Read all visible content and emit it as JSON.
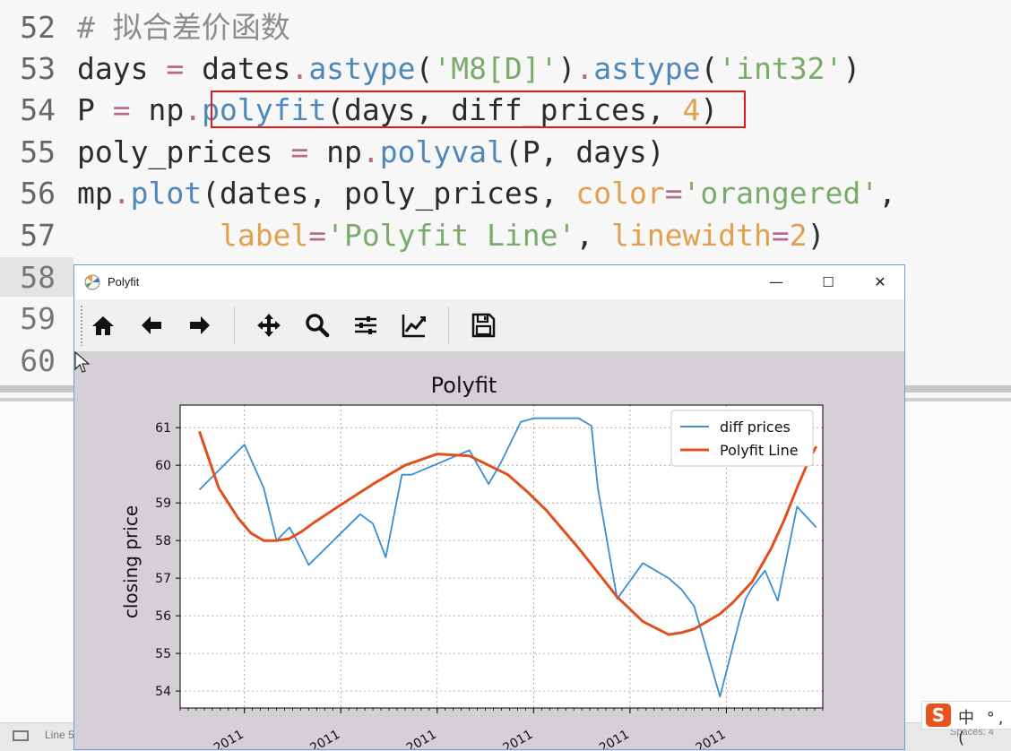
{
  "editor": {
    "lines": [
      {
        "num": "52",
        "tokens": [
          [
            "cm",
            "# 拟合差价函数"
          ]
        ]
      },
      {
        "num": "53",
        "tokens": [
          [
            "id",
            "days "
          ],
          [
            "op",
            "="
          ],
          [
            "id",
            " dates"
          ],
          [
            "op",
            "."
          ],
          [
            "fn",
            "astype"
          ],
          [
            "id",
            "("
          ],
          [
            "str",
            "'M8[D]'"
          ],
          [
            "id",
            ")"
          ],
          [
            "op",
            "."
          ],
          [
            "fn",
            "astype"
          ],
          [
            "id",
            "("
          ],
          [
            "str",
            "'int32'"
          ],
          [
            "id",
            ")"
          ]
        ]
      },
      {
        "num": "54",
        "tokens": [
          [
            "id",
            "P "
          ],
          [
            "op",
            "="
          ],
          [
            "id",
            " np"
          ],
          [
            "op",
            "."
          ],
          [
            "fn",
            "polyfit"
          ],
          [
            "id",
            "(days, diff_prices, "
          ],
          [
            "num",
            "4"
          ],
          [
            "id",
            ")"
          ]
        ]
      },
      {
        "num": "55",
        "tokens": [
          [
            "id",
            "poly_prices "
          ],
          [
            "op",
            "="
          ],
          [
            "id",
            " np"
          ],
          [
            "op",
            "."
          ],
          [
            "fn",
            "polyval"
          ],
          [
            "id",
            "(P, days)"
          ]
        ]
      },
      {
        "num": "56",
        "tokens": [
          [
            "id",
            "mp"
          ],
          [
            "op",
            "."
          ],
          [
            "fn",
            "plot"
          ],
          [
            "id",
            "(dates, poly_prices, "
          ],
          [
            "kw",
            "color"
          ],
          [
            "op",
            "="
          ],
          [
            "str",
            "'orangered'"
          ],
          [
            "id",
            ","
          ]
        ]
      },
      {
        "num": "57",
        "tokens": [
          [
            "id",
            "        "
          ],
          [
            "kw",
            "label"
          ],
          [
            "op",
            "="
          ],
          [
            "str",
            "'Polyfit Line'"
          ],
          [
            "id",
            ", "
          ],
          [
            "kw",
            "linewidth"
          ],
          [
            "op",
            "="
          ],
          [
            "num",
            "2"
          ],
          [
            "id",
            ")"
          ]
        ]
      },
      {
        "num": "58",
        "tokens": []
      },
      {
        "num": "59",
        "tokens": []
      },
      {
        "num": "60",
        "tokens": []
      }
    ]
  },
  "status": {
    "line_label": "Line 5",
    "spaces_label": "Spaces: 4"
  },
  "ime": {
    "logo": "S",
    "text": "中 °, ("
  },
  "window": {
    "title": "Polyfit",
    "minimize": "—",
    "maximize": "☐",
    "close": "✕",
    "toolbar": [
      "home-icon",
      "back-arrow-icon",
      "forward-arrow-icon",
      "pan-icon",
      "zoom-icon",
      "subplots-icon",
      "edit-axis-icon",
      "save-icon"
    ]
  },
  "colors": {
    "diff": "#3a8fd1",
    "poly": "#e0501e",
    "highlight": "#e0191c"
  },
  "chart_data": {
    "type": "line",
    "title": "Polyfit",
    "xlabel": "",
    "ylabel": "closing price",
    "ylim": [
      53.55,
      61.6
    ],
    "yticks": [
      54,
      55,
      56,
      57,
      58,
      59,
      60,
      61
    ],
    "xticks": [
      "2011",
      "2011",
      "2011",
      "2011",
      "2011",
      "2011"
    ],
    "grid": true,
    "legend_position": "top-right",
    "series": [
      {
        "name": "diff prices",
        "color": "#3a8fd1",
        "x": [
          0.03,
          0.1,
          0.13,
          0.15,
          0.17,
          0.18,
          0.2,
          0.28,
          0.3,
          0.32,
          0.345,
          0.36,
          0.45,
          0.48,
          0.5,
          0.53,
          0.55,
          0.6,
          0.61,
          0.62,
          0.64,
          0.65,
          0.68,
          0.72,
          0.76,
          0.78,
          0.8,
          0.84,
          0.87,
          0.88,
          0.89,
          0.91,
          0.93,
          0.96,
          0.99
        ],
        "y": [
          59.35,
          60.55,
          59.4,
          58.0,
          58.35,
          58.05,
          57.35,
          58.7,
          58.45,
          57.55,
          59.75,
          59.75,
          60.4,
          59.5,
          60.1,
          61.15,
          61.25,
          61.25,
          61.25,
          61.25,
          61.05,
          59.4,
          56.45,
          57.4,
          57.0,
          56.7,
          56.25,
          53.85,
          55.85,
          56.45,
          56.75,
          57.2,
          56.4,
          58.9,
          58.35
        ]
      },
      {
        "name": "Polyfit Line",
        "color": "#e0501e",
        "x": [
          0.03,
          0.06,
          0.09,
          0.11,
          0.13,
          0.15,
          0.17,
          0.19,
          0.21,
          0.25,
          0.3,
          0.35,
          0.4,
          0.45,
          0.48,
          0.51,
          0.54,
          0.57,
          0.62,
          0.68,
          0.72,
          0.76,
          0.78,
          0.8,
          0.82,
          0.84,
          0.86,
          0.89,
          0.92,
          0.94,
          0.96,
          0.98,
          0.99
        ],
        "y": [
          60.9,
          59.4,
          58.6,
          58.2,
          58.0,
          58.0,
          58.05,
          58.25,
          58.5,
          58.95,
          59.5,
          60.0,
          60.3,
          60.25,
          60.0,
          59.75,
          59.3,
          58.8,
          57.8,
          56.5,
          55.85,
          55.5,
          55.55,
          55.65,
          55.85,
          56.05,
          56.35,
          56.9,
          57.8,
          58.55,
          59.4,
          60.2,
          60.5
        ]
      }
    ]
  }
}
